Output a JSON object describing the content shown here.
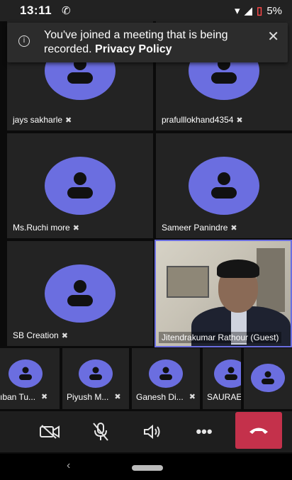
{
  "status_bar": {
    "time": "13:11",
    "battery": "5%"
  },
  "banner": {
    "message": "You've joined a meeting that is being recorded.",
    "link": "Privacy Policy"
  },
  "participants": [
    {
      "name": "jays sakharle"
    },
    {
      "name": "prafulllokhand4354"
    },
    {
      "name": "Ms.Ruchi more"
    },
    {
      "name": "Sameer Panindre"
    },
    {
      "name": "SB Creation"
    },
    {
      "name": "Jitendrakumar Rathour (Guest)"
    }
  ],
  "strip": [
    {
      "name": "ıban Tu..."
    },
    {
      "name": "Piyush M..."
    },
    {
      "name": "Ganesh Di..."
    },
    {
      "name": "SAURAE"
    },
    {
      "name": ""
    }
  ],
  "colors": {
    "avatar": "#6b6ee0",
    "hangup": "#c4314b"
  },
  "icons": {
    "mic_off": "mic-off-icon",
    "camera_off": "camera-off-icon",
    "speaker": "speaker-icon",
    "more": "more-icon",
    "hangup": "phone-hangup-icon"
  }
}
